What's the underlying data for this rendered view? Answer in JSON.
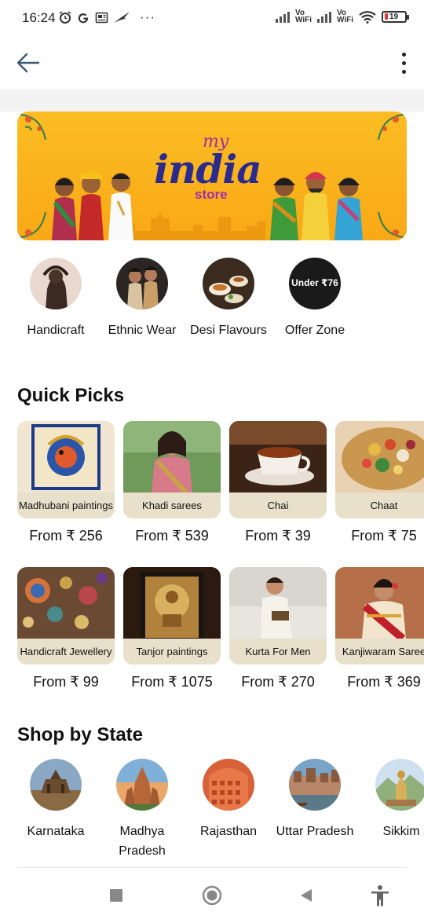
{
  "status_bar": {
    "time": "16:24",
    "left_icons": [
      "alarm-icon",
      "google-icon",
      "news-icon",
      "bird-icon"
    ],
    "more_dots": "···",
    "vo_label": "Vo",
    "wifi_label": "WiFi",
    "battery": "19",
    "battery_color": "#e53935"
  },
  "app_bar": {
    "back_icon": "arrow-left-icon",
    "menu_icon": "more-vertical-icon"
  },
  "banner": {
    "my": "my",
    "india": "india",
    "store": "store",
    "bg_color": "#fbbd23",
    "brand_color": "#2b2a8e",
    "accent_color": "#a02ca6"
  },
  "categories": [
    {
      "label": "Handicraft"
    },
    {
      "label": "Ethnic Wear"
    },
    {
      "label": "Desi Flavours"
    },
    {
      "label": "Offer Zone",
      "badge": "Under ₹76"
    }
  ],
  "quick_picks": {
    "title": "Quick Picks",
    "row1": [
      {
        "name": "Madhubani paintings",
        "price": "From ₹ 256"
      },
      {
        "name": "Khadi sarees",
        "price": "From ₹ 539"
      },
      {
        "name": "Chai",
        "price": "From ₹ 39"
      },
      {
        "name": "Chaat",
        "price": "From ₹ 75"
      }
    ],
    "row2": [
      {
        "name": "Handicraft Jewellery",
        "price": "From ₹ 99"
      },
      {
        "name": "Tanjor paintings",
        "price": "From ₹ 1075"
      },
      {
        "name": "Kurta For Men",
        "price": "From ₹ 270"
      },
      {
        "name": "Kanjiwaram Saree",
        "price": "From ₹ 369"
      }
    ]
  },
  "shop_by_state": {
    "title": "Shop by State",
    "states": [
      {
        "label": "Karnataka"
      },
      {
        "label": "Madhya Pradesh"
      },
      {
        "label": "Rajasthan"
      },
      {
        "label": "Uttar Pradesh"
      },
      {
        "label": "Sikkim"
      }
    ]
  },
  "nav_bar": {
    "icons": [
      "recents-square-icon",
      "home-circle-icon",
      "back-triangle-icon",
      "accessibility-icon"
    ]
  }
}
